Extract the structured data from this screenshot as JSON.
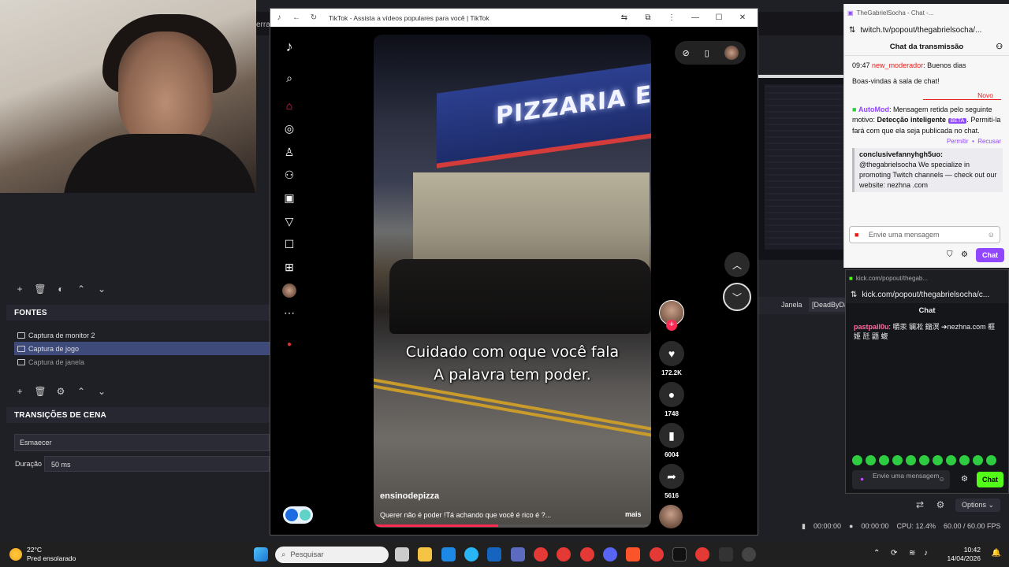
{
  "obs": {
    "top_text": "erra",
    "sources_title": "FONTES",
    "sources": [
      {
        "label": "Captura de monitor 2",
        "selected": false
      },
      {
        "label": "Captura de jogo",
        "selected": true
      },
      {
        "label": "Captura de janela",
        "selected": false
      }
    ],
    "transitions_title": "TRANSIÇÕES DE CENA",
    "transition_value": "Esmaecer",
    "duration_label": "Duração",
    "duration_value": "50 ms",
    "janela_label": "Janela",
    "janela_value": "[DeadByDay",
    "status": {
      "rec_time": "00:00:00",
      "stream_time": "00:00:00",
      "cpu": "CPU: 12.4%",
      "fps": "60.00 / 60.00 FPS"
    },
    "options_label": "Options"
  },
  "tiktok": {
    "window_title": "TikTok - Assista a vídeos populares para você | TikTok",
    "sign_text": "PIZZARIA E R",
    "caption_line1": "Cuidado com oque você fala",
    "caption_line2": "A palavra tem poder.",
    "author": "ensinodepizza",
    "description": "Querer não é poder !Tá achando que você é rico é ?...",
    "more_label": "mais",
    "likes": "172.2K",
    "comments": "1748",
    "saves": "6004",
    "shares": "5616",
    "progress": 0.45,
    "accent_color": "#fe2c55"
  },
  "twitch": {
    "window_title": "TheGabrielSocha - Chat -...",
    "url": "twitch.tv/popout/thegabrielsocha/...",
    "header": "Chat da transmissão",
    "msg1_time": "09:47",
    "msg1_user": "new_moderador",
    "msg1_text": ": Buenos dias",
    "welcome": "Boas-vindas à sala de chat!",
    "new_label": "Novo",
    "automod_user": "AutoMod",
    "automod_text1": ": Mensagem retida pelo seguinte motivo: ",
    "automod_reason": "Detecção inteligente",
    "beta_label": "BETA",
    "automod_text2": ". Permiti-la fará com que ela seja publicada no chat.",
    "allow_label": "Permitir",
    "deny_label": "Recusar",
    "held_user": "conclusivefannyhgh5uo:",
    "held_text": "@thegabrielsocha We specialize in promoting Twitch channels — check out our website: nezhna .com",
    "input_placeholder": "Envie uma mensagem",
    "chat_button": "Chat",
    "brand_color": "#9147ff"
  },
  "kick": {
    "window_title": "kick.com/popout/thegab...",
    "url": "kick.com/popout/thegabrielsocha/c...",
    "header": "Chat",
    "msg_user": "pastpall0u",
    "msg_text": ": 嚼汞 镧凇 鎦溟 ➔nezhna.com 榧 姬 瓩 鼯 蝮",
    "input_placeholder": "Envie uma mensagem",
    "chat_button": "Chat",
    "brand_color": "#53fc18"
  },
  "taskbar": {
    "temperature": "22°C",
    "weather": "Pred ensolarado",
    "search_placeholder": "Pesquisar",
    "time": "10:42",
    "date": "14/04/2026"
  }
}
